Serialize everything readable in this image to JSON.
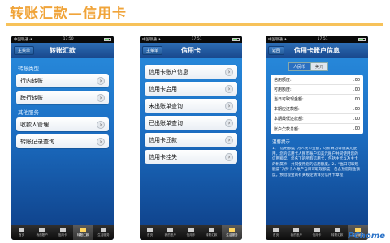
{
  "slide": {
    "title": "转账汇款—信用卡",
    "watermark": "PChome"
  },
  "status_bar": {
    "carrier": "中国联通 ✈",
    "time_1": "17:50",
    "time_2": "17:51",
    "time_3": "17:51"
  },
  "tabs": [
    "首页",
    "我的账户",
    "信用卡",
    "转账汇款",
    "生活服务"
  ],
  "phone1": {
    "back": "主菜单",
    "title": "转账汇款",
    "section1": "转账类型",
    "section1_items": [
      "行内转账",
      "跨行转账"
    ],
    "section2": "其他服务",
    "section2_items": [
      "收款人管理",
      "转账记录查询"
    ],
    "active_tab": 3
  },
  "phone2": {
    "back": "主菜单",
    "title": "信用卡",
    "items": [
      "信用卡账户信息",
      "信用卡启用",
      "未出账单查询",
      "已出账单查询",
      "信用卡还款",
      "信用卡挂失"
    ],
    "active_tab": 4
  },
  "phone3": {
    "back": "返回",
    "title": "信用卡账户信息",
    "seg_on": "人民币",
    "seg_off": "美元",
    "rows": [
      {
        "label": "信用额度:",
        "value": ".00"
      },
      {
        "label": "可用额度:",
        "value": ".00"
      },
      {
        "label": "当日可取现金额:",
        "value": ".00"
      },
      {
        "label": "本期应还款额:",
        "value": ".00"
      },
      {
        "label": "本期最低还款额:",
        "value": ".00"
      },
      {
        "label": "账户欠款总额:",
        "value": ".00"
      }
    ],
    "tips_title": "温馨提示",
    "tips_text": "1、“信用额度”为人民币金额，可折算为等值美元使用，您的信用卡人民币账户和美元账户共同使用您的信用额度。您名下的所有信用卡，包括主卡以及主卡的附属卡，共同使用您的信用额度。2、“当日可取现额度”为持卡人账户当日可取现额度，包含预借现金额度。预借现金的有关规定请详见信用卡章程",
    "active_tab": 4
  }
}
